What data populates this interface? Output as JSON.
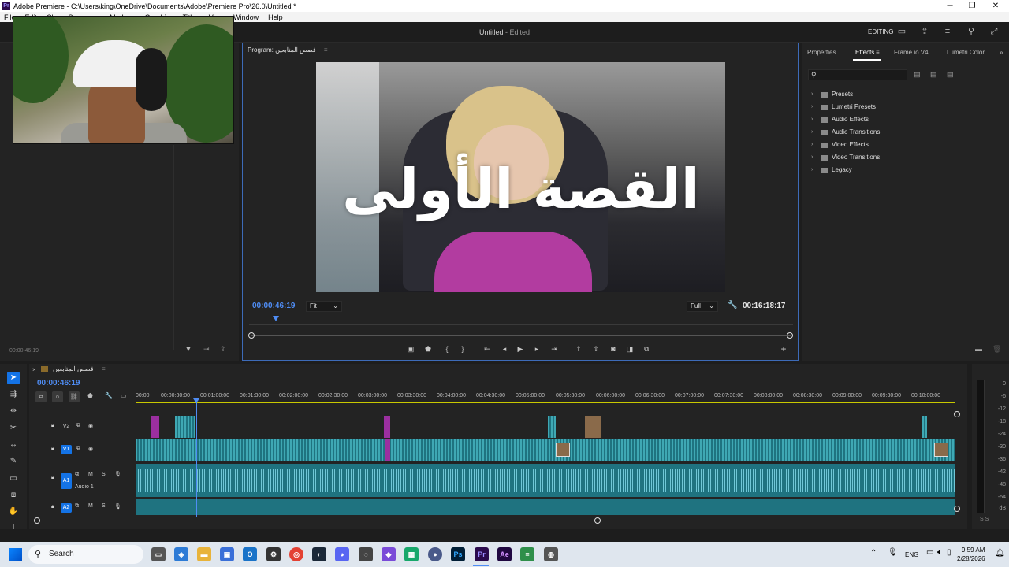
{
  "window": {
    "title": "Adobe Premiere - C:\\Users\\king\\OneDrive\\Documents\\Adobe\\Premiere Pro\\26.0\\Untitled *",
    "menu": [
      "File",
      "Edit",
      "Clip",
      "Sequence",
      "Markers",
      "Graphics",
      "Titles",
      "View",
      "Window",
      "Help"
    ]
  },
  "header": {
    "project_title": "Untitled",
    "project_status": "- Edited",
    "workspace": "EDITING"
  },
  "left_panel": {
    "timecode": "00:00:46:19"
  },
  "program": {
    "tab_label": "Program: قصص المتابعين",
    "caption": "القصة الأولى",
    "current_timecode": "00:00:46:19",
    "duration_timecode": "00:16:18:17",
    "fit_select": "Fit",
    "resolution_select": "Full"
  },
  "effects_panel": {
    "tabs": [
      "Properties",
      "Effects",
      "Frame.io V4",
      "Lumetri Color"
    ],
    "active_tab": "Effects",
    "search_placeholder": "",
    "items": [
      "Presets",
      "Lumetri Presets",
      "Audio Effects",
      "Audio Transitions",
      "Video Effects",
      "Video Transitions",
      "Legacy"
    ]
  },
  "timeline": {
    "sequence_name": "قصص المتابعين",
    "timecode": "00:00:46:19",
    "ruler_labels": [
      "00:00",
      "00:00:30:00",
      "00:01:00:00",
      "00:01:30:00",
      "00:02:00:00",
      "00:02:30:00",
      "00:03:00:00",
      "00:03:30:00",
      "00:04:00:00",
      "00:04:30:00",
      "00:05:00:00",
      "00:05:30:00",
      "00:06:00:00",
      "00:06:30:00",
      "00:07:00:00",
      "00:07:30:00",
      "00:08:00:00",
      "00:08:30:00",
      "00:09:00:00",
      "00:09:30:00",
      "00:10:00:00"
    ],
    "tracks": [
      {
        "id": "V2",
        "kind": "video"
      },
      {
        "id": "V1",
        "kind": "video"
      },
      {
        "id": "A1",
        "kind": "audio",
        "name": "Audio 1"
      },
      {
        "id": "A2",
        "kind": "audio"
      }
    ],
    "track_buttons": {
      "mute": "M",
      "solo": "S"
    }
  },
  "meter": {
    "labels": [
      "0",
      "-6",
      "-12",
      "-18",
      "-24",
      "-30",
      "-36",
      "-42",
      "-48",
      "-54",
      "dB"
    ],
    "solo_labels": "S S"
  },
  "taskbar": {
    "search_label": "Search",
    "lang": "ENG",
    "time": "9:59 AM",
    "date": "2/28/2026"
  }
}
